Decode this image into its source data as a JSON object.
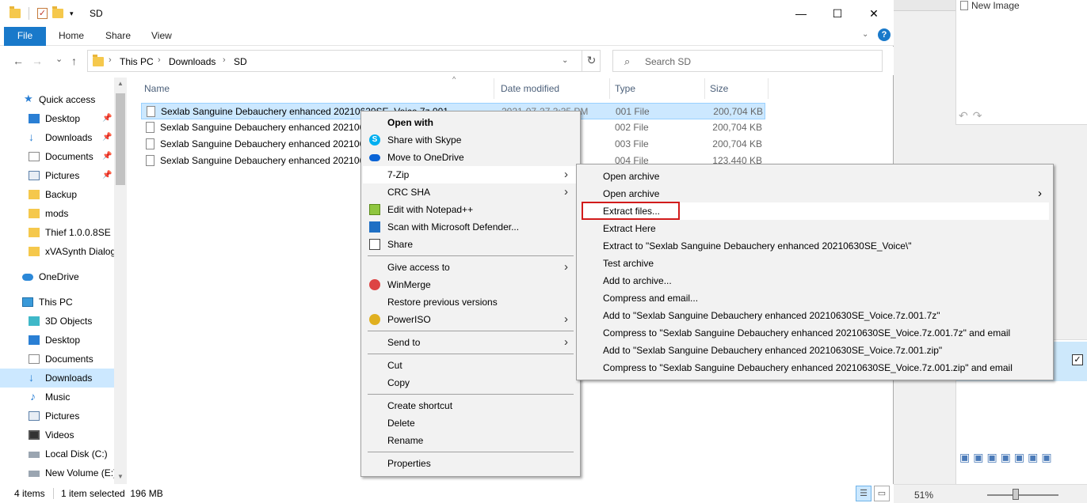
{
  "background_app": {
    "new_image_label": "New Image",
    "zoom_level": "51%"
  },
  "window": {
    "title": "SD",
    "minimize": "—",
    "maximize": "☐",
    "close": "✕"
  },
  "ribbon": {
    "tabs": [
      "File",
      "Home",
      "Share",
      "View"
    ],
    "help": "?"
  },
  "address": {
    "back": "←",
    "forward": "→",
    "recent": "⌄",
    "up": "↑",
    "crumbs": [
      "This PC",
      "Downloads",
      "SD"
    ],
    "refresh": "↻",
    "search_placeholder": "Search SD"
  },
  "navpane": {
    "items": [
      {
        "label": "Quick access",
        "icon": "star-icon"
      },
      {
        "label": "Desktop",
        "icon": "desktop-icon",
        "pinned": true
      },
      {
        "label": "Downloads",
        "icon": "download-icon",
        "pinned": true
      },
      {
        "label": "Documents",
        "icon": "document-icon",
        "pinned": true
      },
      {
        "label": "Pictures",
        "icon": "pictures-icon",
        "pinned": true
      },
      {
        "label": "Backup",
        "icon": "folder-icon"
      },
      {
        "label": "mods",
        "icon": "folder-icon"
      },
      {
        "label": "Thief 1.0.0.8SE",
        "icon": "folder-icon"
      },
      {
        "label": "xVASynth Dialog",
        "icon": "folder-icon"
      },
      {
        "label": "OneDrive",
        "icon": "cloud-icon"
      },
      {
        "label": "This PC",
        "icon": "computer-icon"
      },
      {
        "label": "3D Objects",
        "icon": "cube-icon"
      },
      {
        "label": "Desktop",
        "icon": "desktop-icon"
      },
      {
        "label": "Documents",
        "icon": "document-icon"
      },
      {
        "label": "Downloads",
        "icon": "download-icon",
        "selected": true
      },
      {
        "label": "Music",
        "icon": "music-icon"
      },
      {
        "label": "Pictures",
        "icon": "pictures-icon"
      },
      {
        "label": "Videos",
        "icon": "video-icon"
      },
      {
        "label": "Local Disk (C:)",
        "icon": "drive-icon"
      },
      {
        "label": "New Volume (E:)",
        "icon": "drive-icon"
      }
    ]
  },
  "file_list": {
    "columns": [
      "Name",
      "Date modified",
      "Type",
      "Size"
    ],
    "rows": [
      {
        "name": "Sexlab Sanguine Debauchery enhanced 20210630SE_Voice.7z.001",
        "date": "2021-07-27 3:35 PM",
        "type": "001 File",
        "size": "200,704 KB",
        "selected": true
      },
      {
        "name": "Sexlab Sanguine Debauchery enhanced 2021063",
        "date": "",
        "type": "002 File",
        "size": "200,704 KB"
      },
      {
        "name": "Sexlab Sanguine Debauchery enhanced 2021063",
        "date": "",
        "type": "003 File",
        "size": "200,704 KB"
      },
      {
        "name": "Sexlab Sanguine Debauchery enhanced 2021063",
        "date": "",
        "type": "004 File",
        "size": "123,440 KB"
      }
    ]
  },
  "context_menu": {
    "items": [
      {
        "label": "Open with",
        "bold": true
      },
      {
        "label": "Share with Skype",
        "icon": "skype-icon"
      },
      {
        "label": "Move to OneDrive",
        "icon": "onedrive-icon"
      },
      {
        "label": "7-Zip",
        "submenu": true,
        "highlighted": true
      },
      {
        "label": "CRC SHA",
        "submenu": true
      },
      {
        "label": "Edit with Notepad++",
        "icon": "notepad-icon"
      },
      {
        "label": "Scan with Microsoft Defender...",
        "icon": "defender-icon"
      },
      {
        "label": "Share",
        "icon": "share-icon"
      },
      {
        "label": "Give access to",
        "submenu": true
      },
      {
        "label": "WinMerge",
        "icon": "winmerge-icon"
      },
      {
        "label": "Restore previous versions"
      },
      {
        "label": "PowerISO",
        "icon": "poweriso-icon",
        "submenu": true
      },
      {
        "label": "Send to",
        "submenu": true
      },
      {
        "label": "Cut"
      },
      {
        "label": "Copy"
      },
      {
        "label": "Create shortcut"
      },
      {
        "label": "Delete"
      },
      {
        "label": "Rename"
      },
      {
        "label": "Properties"
      }
    ]
  },
  "zip_submenu": {
    "items": [
      {
        "label": "Open archive"
      },
      {
        "label": "Open archive",
        "submenu": true
      },
      {
        "label": "Extract files...",
        "highlighted": true
      },
      {
        "label": "Extract Here"
      },
      {
        "label": "Extract to \"Sexlab Sanguine Debauchery enhanced 20210630SE_Voice\\\""
      },
      {
        "label": "Test archive"
      },
      {
        "label": "Add to archive..."
      },
      {
        "label": "Compress and email..."
      },
      {
        "label": "Add to \"Sexlab Sanguine Debauchery enhanced 20210630SE_Voice.7z.001.7z\""
      },
      {
        "label": "Compress to \"Sexlab Sanguine Debauchery enhanced 20210630SE_Voice.7z.001.7z\" and email"
      },
      {
        "label": "Add to \"Sexlab Sanguine Debauchery enhanced 20210630SE_Voice.7z.001.zip\""
      },
      {
        "label": "Compress to \"Sexlab Sanguine Debauchery enhanced 20210630SE_Voice.7z.001.zip\" and email"
      }
    ]
  },
  "status": {
    "count": "4 items",
    "selection": "1 item selected  196 MB"
  },
  "colors": {
    "accent": "#1979ca",
    "selection": "#cce8ff",
    "highlight_box": "#d21b1b"
  }
}
